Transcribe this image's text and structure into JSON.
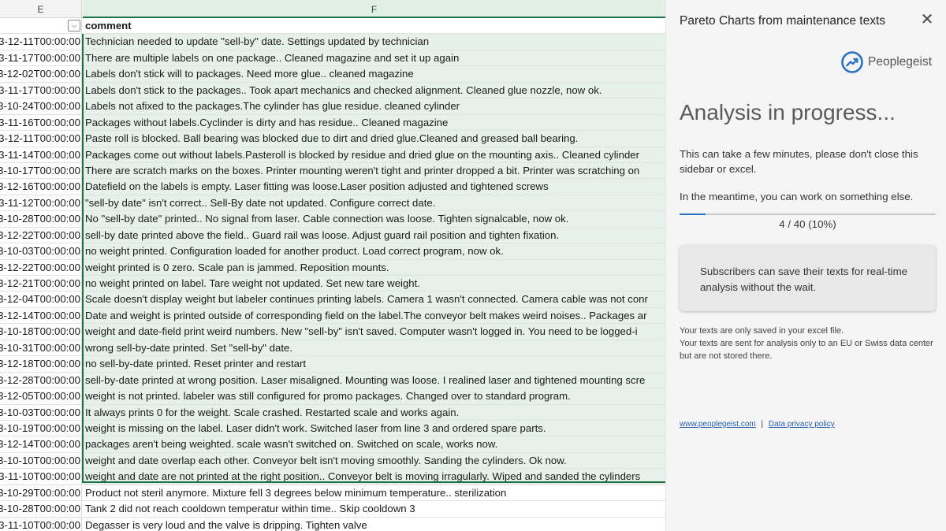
{
  "sheet": {
    "column_e_header": "E",
    "column_f_header": "F",
    "dropdown_glyph": "⌵",
    "comment_header": "comment",
    "rows": [
      {
        "date": "3-12-11T00:00:00",
        "comment": "Technician needed to update \"sell-by\" date. Settings updated by technician"
      },
      {
        "date": "3-11-17T00:00:00",
        "comment": "There are multiple labels on one package.. Cleaned magazine and set it up again"
      },
      {
        "date": "3-12-02T00:00:00",
        "comment": "Labels don't stick will to packages. Need more glue.. cleaned magazine"
      },
      {
        "date": "3-11-17T00:00:00",
        "comment": "Labels don't stick to the packages.. Took apart mechanics and checked alignment. Cleaned glue nozzle, now ok."
      },
      {
        "date": "3-10-24T00:00:00",
        "comment": "Labels not afixed to the packages.The cylinder has glue residue. cleaned cylinder"
      },
      {
        "date": "3-11-16T00:00:00",
        "comment": "Packages without labels.Cyclinder is dirty and has residue.. Cleaned magazine"
      },
      {
        "date": "3-12-11T00:00:00",
        "comment": "Paste roll is blocked. Ball bearing was blocked due to dirt and dried glue.Cleaned and greased ball bearing."
      },
      {
        "date": "3-11-14T00:00:00",
        "comment": "Packages come out without labels.Pasteroll is blocked by residue and dried glue on the mounting axis.. Cleaned cylinder"
      },
      {
        "date": "3-10-17T00:00:00",
        "comment": "There are scratch marks on the boxes. Printer mounting weren't tight and printer dropped a bit. Printer was scratching on"
      },
      {
        "date": "3-12-16T00:00:00",
        "comment": "Datefield on the labels is empty. Laser fitting was loose.Laser position adjusted and tightened screws"
      },
      {
        "date": "3-11-12T00:00:00",
        "comment": "\"sell-by date\" isn't correct.. Sell-By date not updated. Configure correct date."
      },
      {
        "date": "3-10-28T00:00:00",
        "comment": "No \"sell-by date\" printed.. No signal from laser. Cable connection was loose. Tighten signalcable, now ok."
      },
      {
        "date": "3-12-22T00:00:00",
        "comment": "sell-by date printed above the field.. Guard rail was loose. Adjust guard rail position and tighten fixation."
      },
      {
        "date": "3-10-03T00:00:00",
        "comment": "no weight printed. Configuration loaded for another product. Load correct program, now ok."
      },
      {
        "date": "3-12-22T00:00:00",
        "comment": "weight printed is 0 zero. Scale pan is jammed. Reposition mounts."
      },
      {
        "date": "3-12-21T00:00:00",
        "comment": "no weight printed on label. Tare weight not updated. Set new tare weight."
      },
      {
        "date": "3-12-04T00:00:00",
        "comment": "Scale doesn't display weight but labeler continues printing labels. Camera 1 wasn't connected. Camera cable was not conr"
      },
      {
        "date": "3-12-14T00:00:00",
        "comment": "Date and weight is printed outside of corresponding field on the label.The conveyor belt makes weird noises.. Packages ar"
      },
      {
        "date": "3-10-18T00:00:00",
        "comment": "weight and date-field print weird numbers. New \"sell-by\" isn't saved. Computer wasn't logged in. You need to be logged-i"
      },
      {
        "date": "3-10-31T00:00:00",
        "comment": "wrong sell-by-date printed. Set \"sell-by\" date."
      },
      {
        "date": "3-12-18T00:00:00",
        "comment": "no sell-by-date printed. Reset printer and restart"
      },
      {
        "date": "3-12-28T00:00:00",
        "comment": "sell-by-date printed at wrong position. Laser misaligned. Mounting was loose. I realined laser and tightened mounting scre"
      },
      {
        "date": "3-12-05T00:00:00",
        "comment": "weight is not printed. labeler was still configured for promo packages. Changed over to standard program."
      },
      {
        "date": "3-10-03T00:00:00",
        "comment": "It always prints 0 for the weight. Scale crashed. Restarted scale and works again."
      },
      {
        "date": "3-10-19T00:00:00",
        "comment": "weight is missing on the label. Laser didn't work. Switched laser from line 3 and ordered spare parts."
      },
      {
        "date": "3-12-14T00:00:00",
        "comment": "packages aren't being weighted. scale wasn't switched on. Switched on scale, works now."
      },
      {
        "date": "3-10-10T00:00:00",
        "comment": "weight and date overlap each other. Conveyor belt isn't moving smoothly. Sanding the cylinders. Ok now."
      },
      {
        "date": "3-11-10T00:00:00",
        "comment": "weight and date are not printed at the right position.. Conveyor belt is moving irragularly. Wiped and sanded the cylinders"
      },
      {
        "date": "3-10-29T00:00:00",
        "comment": "Product not steril anymore. Mixture fell 3 degrees below minimum temperature.. sterilization"
      },
      {
        "date": "3-10-28T00:00:00",
        "comment": "Tank 2 did not reach cooldown temperatur within time.. Skip cooldown 3"
      },
      {
        "date": "3-11-10T00:00:00",
        "comment": "Degasser is very loud and the valve is dripping. Tighten valve"
      }
    ]
  },
  "sidebar": {
    "title": "Pareto Charts from maintenance texts",
    "close_glyph": "✕",
    "brand_name": "Peoplegeist",
    "brand_icon": "trend-up-circle-icon",
    "status_heading": "Analysis in progress...",
    "message_1": "This can take a few minutes, please don't close this sidebar or excel.",
    "message_2": "In the meantime, you can work on something else.",
    "progress_fraction": 0.1,
    "progress_text": "4 / 40 (10%)",
    "promo_text": "Subscribers can save their texts for real-time analysis without the wait.",
    "privacy_line_1": "Your texts are only saved in your excel file.",
    "privacy_line_2": "Your texts are sent for analysis only to an EU or Swiss data center but are not stored there.",
    "link_website": "www.peoplegeist.com",
    "link_separator": "|",
    "link_privacy": "Data privacy policy",
    "accent_color": "#2a72c4",
    "selection_color": "#1e7145"
  }
}
